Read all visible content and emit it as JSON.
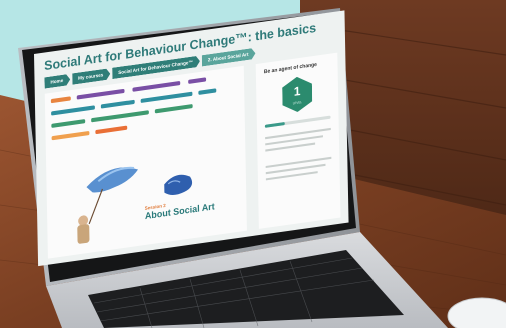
{
  "course_page": {
    "title": "Social Art for Behaviour Change™: the basics",
    "breadcrumbs": [
      "Home",
      "My courses",
      "Social Art for Behaviour Change™",
      "2. About Social Art"
    ],
    "session_label": "Session 2",
    "section_heading": "About Social Art",
    "agent_panel": {
      "title": "Be an agent of change",
      "level": "1",
      "level_caption": "LEVEL",
      "progress": 0.3
    }
  },
  "colors": {
    "wall": "#b6e6e6",
    "table_wood": "#8a4a2b",
    "laptop_silver": "#c9ccd0",
    "bezel": "#151617",
    "accent_teal": "#2e7a79",
    "badge_green": "#2b8b6e"
  }
}
